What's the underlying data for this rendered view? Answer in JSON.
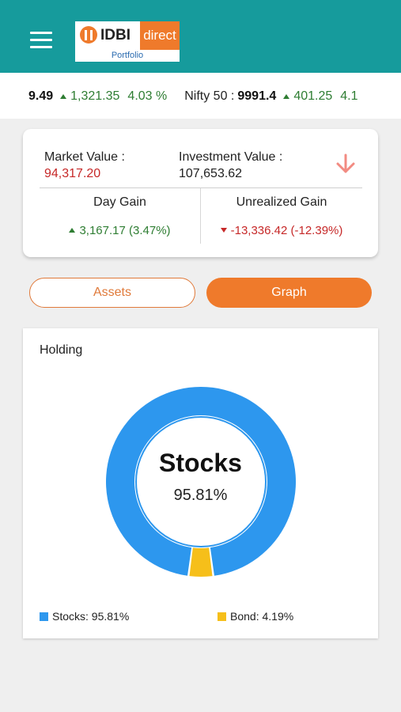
{
  "app": {
    "logo_brand": "IDBI",
    "logo_suffix": "direct",
    "logo_subtitle": "Portfolio"
  },
  "ticker": {
    "items": [
      {
        "name": "",
        "value": "9.49",
        "change": "1,321.35",
        "percent": "4.03 %",
        "direction": "up"
      },
      {
        "name": "Nifty 50 :",
        "value": "9991.4",
        "change": "401.25",
        "percent": "4.1",
        "direction": "up"
      }
    ]
  },
  "summary": {
    "market_value_label": "Market Value :",
    "market_value": "94,317.20",
    "investment_value_label": "Investment Value :",
    "investment_value": "107,653.62",
    "trend_icon": "arrow-down-icon",
    "day_gain_label": "Day Gain",
    "day_gain_value": "3,167.17 (3.47%)",
    "unrealized_gain_label": "Unrealized Gain",
    "unrealized_gain_value": "-13,336.42 (-12.39%)"
  },
  "tabs": {
    "assets_label": "Assets",
    "graph_label": "Graph",
    "active": "graph"
  },
  "holding": {
    "title": "Holding",
    "center_title": "Stocks",
    "center_value": "95.81%"
  },
  "chart_data": {
    "type": "pie",
    "title": "Holding",
    "series": [
      {
        "name": "Stocks",
        "value": 95.81,
        "color": "#2d97ee"
      },
      {
        "name": "Bond",
        "value": 4.19,
        "color": "#f6bf1a"
      }
    ],
    "legend_labels": [
      "Stocks: 95.81%",
      "Bond: 4.19%"
    ],
    "legend_placement": "bottom"
  },
  "colors": {
    "appbar": "#169b9c",
    "accent": "#ef7a2b",
    "gain": "#2e7d32",
    "loss": "#c62828"
  }
}
